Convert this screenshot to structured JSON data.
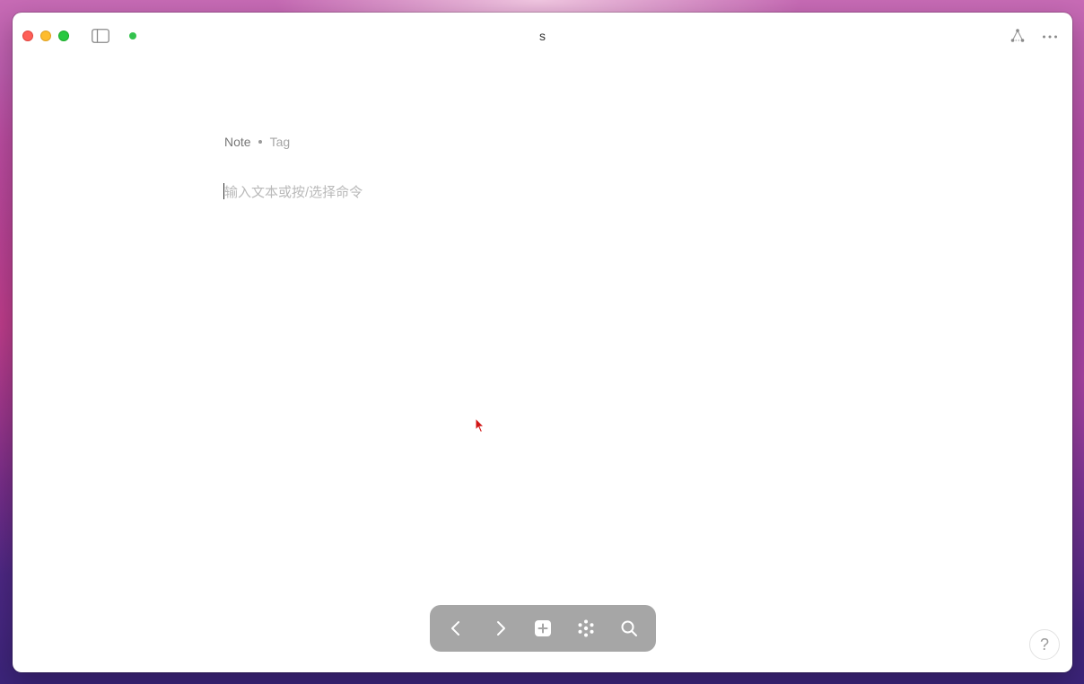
{
  "window": {
    "title": "s",
    "sync_status_color": "#33c24d"
  },
  "toolbar": {
    "left_icons": [
      "sidebar-toggle-icon"
    ],
    "right_icons": [
      "graph-icon",
      "more-icon"
    ]
  },
  "document": {
    "type_label": "Note",
    "tag_placeholder": "Tag",
    "editor_placeholder": "输入文本或按/选择命令"
  },
  "bottom_bar": {
    "background_color": "#a6a6a6",
    "buttons": [
      "back-icon",
      "forward-icon",
      "new-page-icon",
      "all-pages-icon",
      "search-icon"
    ]
  },
  "help": {
    "label": "?"
  }
}
